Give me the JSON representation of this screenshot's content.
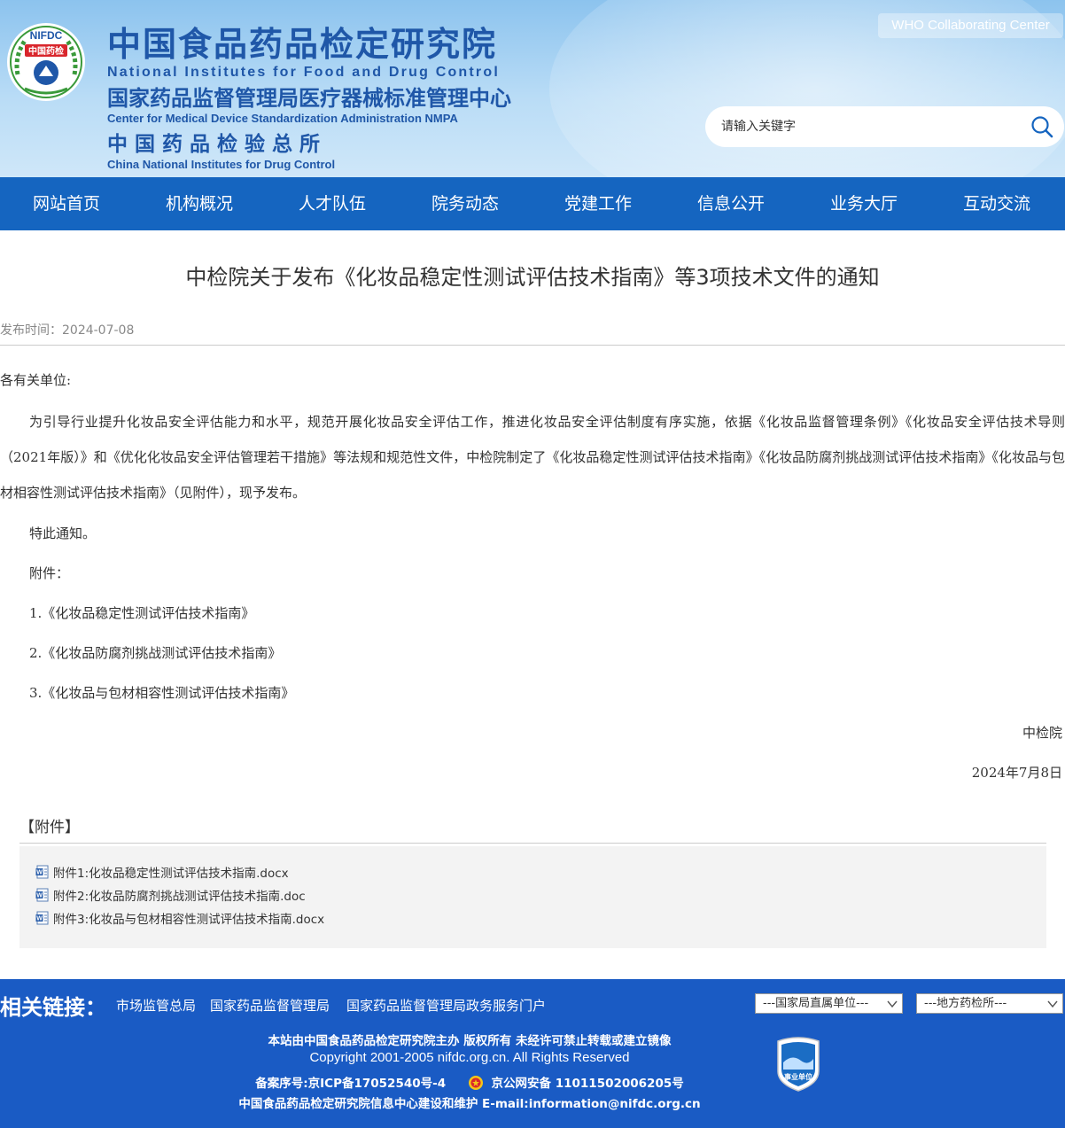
{
  "header": {
    "title_cn": "中国食品药品检定研究院",
    "title_en": "National Institutes for Food and Drug Control",
    "subtitle_cn": "国家药品监督管理局医疗器械标准管理中心",
    "subtitle_en": "Center for Medical Device Standardization Administration NMPA",
    "third_cn": "中国药品检验总所",
    "third_en": "China National Institutes for Drug Control",
    "logo_text_top": "NIFDC",
    "logo_text_mid": "中国药检",
    "who_badge": "WHO Collaborating Center",
    "search_placeholder": "请输入关键字",
    "colors": {
      "brand_blue": "#1f57a8",
      "nav_blue": "#1565c0",
      "footer_blue": "#1a5bc4"
    }
  },
  "nav": {
    "items": [
      "网站首页",
      "机构概况",
      "人才队伍",
      "院务动态",
      "党建工作",
      "信息公开",
      "业务大厅",
      "互动交流"
    ]
  },
  "article": {
    "title": "中检院关于发布《化妆品稳定性测试评估技术指南》等3项技术文件的通知",
    "date_label": "发布时间：2024-07-08",
    "greeting": "各有关单位:",
    "paragraph": "为引导行业提升化妆品安全评估能力和水平，规范开展化妆品安全评估工作，推进化妆品安全评估制度有序实施，依据《化妆品监督管理条例》《化妆品安全评估技术导则（2021年版）》和《优化化妆品安全评估管理若干措施》等法规和规范性文件，中检院制定了《化妆品稳定性测试评估技术指南》《化妆品防腐剂挑战测试评估技术指南》《化妆品与包材相容性测试评估技术指南》（见附件），现予发布。",
    "notice": "特此通知。",
    "attachments_label": "附件：",
    "attachment_list": [
      "1.《化妆品稳定性测试评估技术指南》",
      "2.《化妆品防腐剂挑战测试评估技术指南》",
      "3.《化妆品与包材相容性测试评估技术指南》"
    ],
    "signature": "中检院",
    "sign_date": "2024年7月8日"
  },
  "attachments": {
    "heading": "【附件】",
    "files": [
      "附件1:化妆品稳定性测试评估技术指南.docx",
      "附件2:化妆品防腐剂挑战测试评估技术指南.doc",
      "附件3:化妆品与包材相容性测试评估技术指南.docx"
    ],
    "icon": "word-doc-icon"
  },
  "footer": {
    "links_label": "相关链接：",
    "links": [
      "市场监管总局",
      "国家药品监督管理局",
      "国家药品监督管理局政务服务门户"
    ],
    "select1": "---国家局直属单位---",
    "select2": "---地方药检所---",
    "host": "本站由中国食品药品检定研究院主办 版权所有 未经许可禁止转载或建立镜像",
    "copyright": "Copyright 2001-2005 nifdc.org.cn. All Rights Reserved",
    "icp": "备案序号:京ICP备17052540号-4",
    "police": "京公网安备 11011502006205号",
    "maintain": "中国食品药品检定研究院信息中心建设和维护 E-mail:information@nifdc.org.cn",
    "badge_text": "事业单位"
  }
}
